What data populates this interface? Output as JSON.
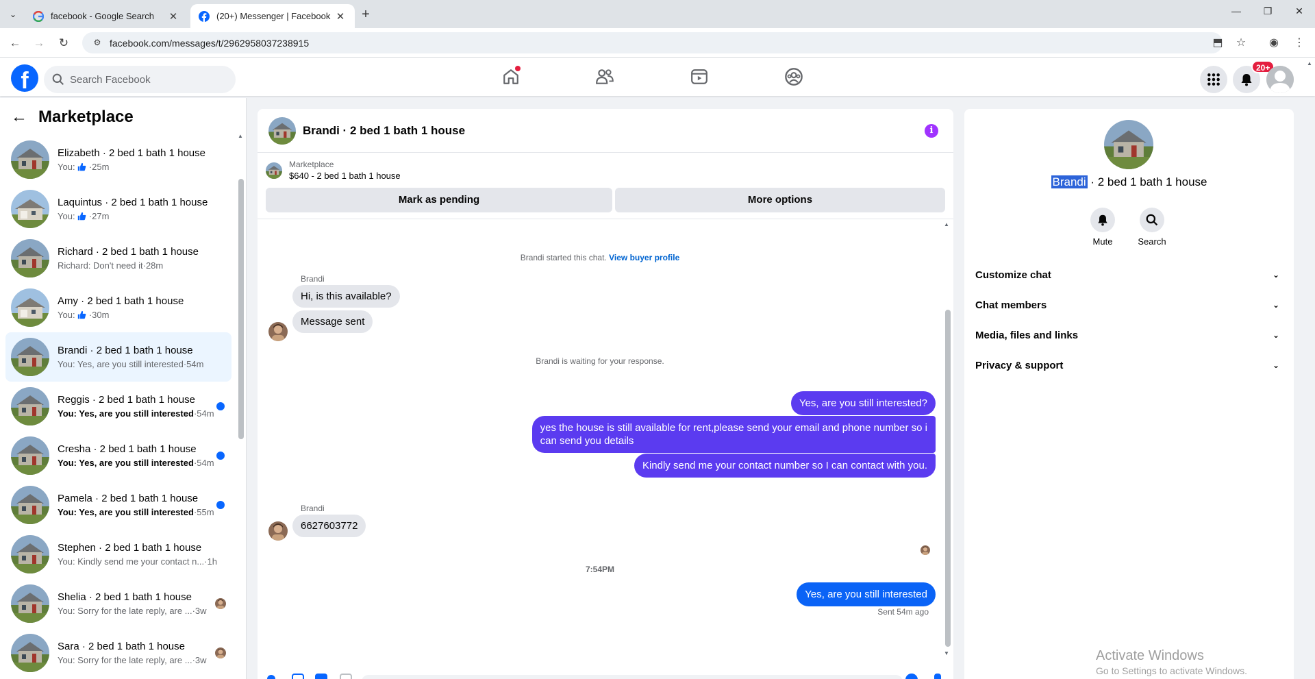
{
  "browser": {
    "tabs": [
      {
        "title": "facebook - Google Search",
        "favicon": "google-icon"
      },
      {
        "title": "(20+) Messenger | Facebook",
        "favicon": "facebook-icon"
      }
    ],
    "url": "facebook.com/messages/t/2962958037238915"
  },
  "fb": {
    "search_placeholder": "Search Facebook",
    "notification_badge": "20+",
    "brand_color": "#0866ff"
  },
  "sidebar": {
    "title": "Marketplace",
    "conversations": [
      {
        "name": "Elizabeth · 2 bed 1 bath 1 house",
        "prefix": "You:",
        "like": true,
        "message": "",
        "time": "·25m",
        "unread": false,
        "indicator": "none"
      },
      {
        "name": "Laquintus · 2 bed 1 bath 1 house",
        "prefix": "You:",
        "like": true,
        "message": "",
        "time": "·27m",
        "unread": false,
        "indicator": "none"
      },
      {
        "name": "Richard · 2 bed 1 bath 1 house",
        "prefix": "Richard:",
        "like": false,
        "message": " Don't need it",
        "time": "·28m",
        "unread": false,
        "indicator": "none"
      },
      {
        "name": "Amy · 2 bed 1 bath 1 house",
        "prefix": "You:",
        "like": true,
        "message": "",
        "time": "·30m",
        "unread": false,
        "indicator": "none"
      },
      {
        "name": "Brandi · 2 bed 1 bath 1 house",
        "prefix": "You:",
        "like": false,
        "message": " Yes, are you still interested",
        "time": "·54m",
        "unread": false,
        "indicator": "none",
        "active": true
      },
      {
        "name": "Reggis · 2 bed 1 bath 1 house",
        "prefix": "You:",
        "like": false,
        "message": " Yes, are you still interested",
        "time": "·54m",
        "unread": true,
        "indicator": "dot"
      },
      {
        "name": "Cresha · 2 bed 1 bath 1 house",
        "prefix": "You:",
        "like": false,
        "message": " Yes, are you still interested",
        "time": "·54m",
        "unread": true,
        "indicator": "dot"
      },
      {
        "name": "Pamela · 2 bed 1 bath 1 house",
        "prefix": "You:",
        "like": false,
        "message": " Yes, are you still interested",
        "time": "·55m",
        "unread": true,
        "indicator": "dot"
      },
      {
        "name": "Stephen · 2 bed 1 bath 1 house",
        "prefix": "You:",
        "like": false,
        "message": " Kindly send me your contact n...",
        "time": "·1h",
        "unread": false,
        "indicator": "none"
      },
      {
        "name": "Shelia · 2 bed 1 bath 1 house",
        "prefix": "You:",
        "like": false,
        "message": " Sorry for the late reply, are ...",
        "time": "·3w",
        "unread": false,
        "indicator": "avatar"
      },
      {
        "name": "Sara · 2 bed 1 bath 1 house",
        "prefix": "You:",
        "like": false,
        "message": " Sorry for the late reply, are ...",
        "time": "·3w",
        "unread": false,
        "indicator": "avatar"
      }
    ]
  },
  "chat": {
    "title": "Brandi · 2 bed 1 bath 1 house",
    "listing_source": "Marketplace",
    "listing_detail": "$640 - 2 bed 1 bath 1 house",
    "mark_pending_label": "Mark as pending",
    "more_options_label": "More options",
    "started_text": "Brandi started this chat.",
    "view_profile_link": "View buyer profile",
    "sender_name": "Brandi",
    "in_msg_1": "Hi, is this available?",
    "in_msg_2": "Message sent",
    "waiting_text": "Brandi is waiting for your response.",
    "out_msg_1": "Yes, are you still interested?",
    "out_msg_2_line1": "yes the house is still available for rent,please send your email and phone number so i",
    "out_msg_2_line2": "can send you details",
    "out_msg_3": "Kindly send me your contact number so I can contact with you.",
    "sender_name_2": "Brandi",
    "in_msg_3": "6627603772",
    "timestamp": "7:54PM",
    "out_msg_4": "Yes, are you still interested",
    "sent_status": "Sent 54m ago",
    "outgoing_color": "#5b3bf0",
    "last_outgoing_color": "#0a63f6"
  },
  "details": {
    "name_highlight": "Brandi",
    "name_rest": " · 2 bed 1 bath 1 house",
    "mute_label": "Mute",
    "search_label": "Search",
    "sections": [
      "Customize chat",
      "Chat members",
      "Media, files and links",
      "Privacy & support"
    ]
  },
  "watermark": {
    "line1": "Activate Windows",
    "line2": "Go to Settings to activate Windows."
  }
}
